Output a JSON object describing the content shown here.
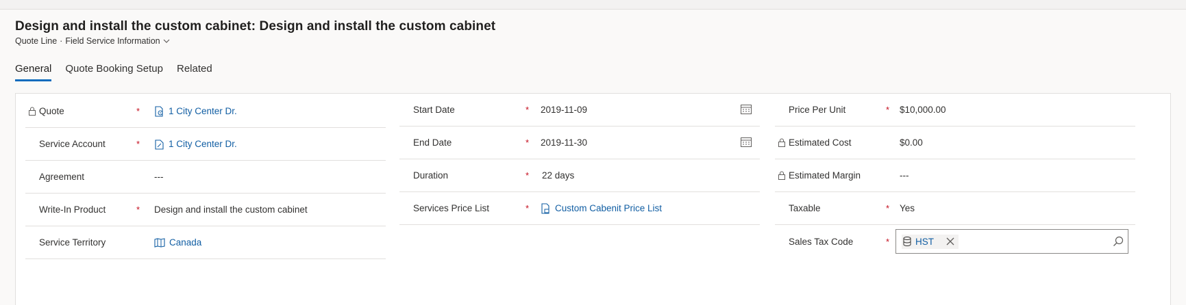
{
  "header": {
    "title": "Design and install the custom cabinet: Design and install the custom cabinet",
    "entity": "Quote Line",
    "separator": "·",
    "form": "Field Service Information"
  },
  "tabs": [
    {
      "label": "General",
      "active": true
    },
    {
      "label": "Quote Booking Setup",
      "active": false
    },
    {
      "label": "Related",
      "active": false
    }
  ],
  "columns": {
    "left": [
      {
        "label": "Quote",
        "required": true,
        "locked": true,
        "value": "1 City Center Dr.",
        "link": true,
        "icon": "quote-document-icon"
      },
      {
        "label": "Service Account",
        "required": true,
        "locked": false,
        "value": "1 City Center Dr.",
        "link": true,
        "icon": "account-icon"
      },
      {
        "label": "Agreement",
        "required": false,
        "locked": false,
        "value": "---",
        "link": false
      },
      {
        "label": "Write-In Product",
        "required": true,
        "locked": false,
        "value": "Design and install the custom cabinet",
        "link": false
      },
      {
        "label": "Service Territory",
        "required": false,
        "locked": false,
        "value": "Canada",
        "link": true,
        "icon": "map-icon"
      }
    ],
    "middle": [
      {
        "label": "Start Date",
        "required": true,
        "value": "2019-11-09",
        "calendar": true
      },
      {
        "label": "End Date",
        "required": true,
        "value": "2019-11-30",
        "calendar": true
      },
      {
        "label": "Duration",
        "required": true,
        "value": "22 days"
      },
      {
        "label": "Services Price List",
        "required": true,
        "value": "Custom Cabenit Price List",
        "link": true,
        "icon": "price-list-icon"
      }
    ],
    "right": [
      {
        "label": "Price Per Unit",
        "required": true,
        "locked": false,
        "value": "$10,000.00"
      },
      {
        "label": "Estimated Cost",
        "required": false,
        "locked": true,
        "value": "$0.00"
      },
      {
        "label": "Estimated Margin",
        "required": false,
        "locked": true,
        "value": "---"
      },
      {
        "label": "Taxable",
        "required": true,
        "locked": false,
        "value": "Yes"
      },
      {
        "label": "Sales Tax Code",
        "required": true,
        "locked": false,
        "lookup_value": "HST"
      }
    ]
  },
  "required_marker": "*",
  "colors": {
    "link": "#115ea3",
    "required": "#c50f1f",
    "accent": "#0f6cbd"
  }
}
